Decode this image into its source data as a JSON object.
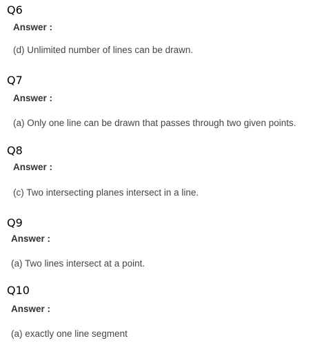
{
  "questions": [
    {
      "number": "Q6",
      "answer_label": "Answer :",
      "answer_text": "(d) Unlimited number of lines can be drawn."
    },
    {
      "number": "Q7",
      "answer_label": "Answer :",
      "answer_text": "(a) Only one line can be drawn that passes through two given points."
    },
    {
      "number": "Q8",
      "answer_label": "Answer :",
      "answer_text": "(c)  Two intersecting planes intersect in a line."
    },
    {
      "number": "Q9",
      "answer_label": "Answer :",
      "answer_text": "(a) Two lines intersect at a point."
    },
    {
      "number": "Q10",
      "answer_label": "Answer :",
      "answer_text": "(a) exactly one line segment"
    }
  ]
}
